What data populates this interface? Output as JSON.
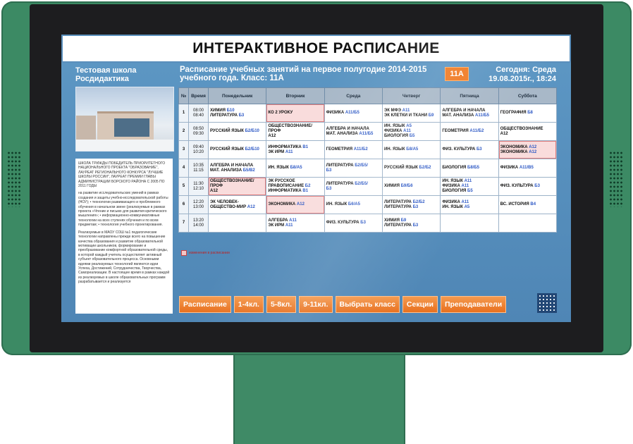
{
  "app": {
    "title": "ИНТЕРАКТИВНОЕ РАСПИСАНИЕ"
  },
  "school": {
    "name_line1": "Тестовая школа",
    "name_line2": "Росдидактика",
    "news": [
      "ШКОЛА ТРИЖДЫ ПОБЕДИТЕЛЬ ПРИОРИТЕТНОГО НАЦИОНАЛЬНОГО ПРОЕКТА \"ОБРАЗОВАНИЕ\", ЛАУРЕАТ РЕГИОНАЛЬНОГО КОНКУРСА \"ЛУЧШИЕ ШКОЛЫ РОССИИ\", ЛАУРЕАТ ПРЕМИИ ГЛАВЫ АДМИНИСТРАЦИИ БОРСКОГО РАЙОНА С 2005 ПО 2011 ГОДЫ",
      "на развитие исследовательских умений в рамках создания и защиты учебно-исследовательской работы (НОУ); • технологии развивающего и проблемного обучения в начальном звене (реализуемые в рамках проекта «Чтение и письмо для развития критического мышления»; • информационно-коммуникативные технологии на всех ступенях обучения и по всем предметам; • технология учебного проектирования.",
      "Реализуемые в МАОУ СОШ №1 педагогические технологии направлены прежде всего на повышение качества образования и развитие образовательной мотивации школьников, формирование и преобразование комфортной образовательной среды, в которой каждый учитель осуществляет активный субъект образовательного процесса. Основными идеями реализуемых технологий являются идеи Успеха, Достижений, Сотрудничества, Творчества, Самореализации. В настоящее время в рамках каждой из реализуемых в школе образовательных программ разрабатывается и реализуется"
    ]
  },
  "schedule": {
    "title_line1": "Расписание учебных занятий на первое полугодие 2014-2015",
    "title_line2": "учебного года. Класс: 11А",
    "class_button": "11А",
    "today_line1": "Сегодня: Среда",
    "today_line2": "19.08.2015г., 18:24",
    "columns": [
      "№",
      "Время",
      "Понедельник",
      "Вторник",
      "Среда",
      "Четверг",
      "Пятница",
      "Суббота"
    ],
    "rows": [
      {
        "num": "1",
        "time": "08:00\n08:40",
        "cells": [
          {
            "hl": false,
            "items": [
              [
                "ХИМИЯ",
                "Б10"
              ],
              [
                "ЛИТЕРАТУРА",
                "Б3"
              ]
            ]
          },
          {
            "hl": true,
            "items": [
              [
                "КО 2 УРОКУ",
                ""
              ]
            ]
          },
          {
            "hl": false,
            "items": [
              [
                "ФИЗИКА",
                "А11/Б5"
              ]
            ]
          },
          {
            "hl": false,
            "items": [
              [
                "ЭК МФЭ",
                "А11"
              ],
              [
                "ЭК КЛЕТКИ И ТКАНИ",
                "Б9"
              ]
            ]
          },
          {
            "hl": false,
            "items": [
              [
                "АЛГЕБРА И НАЧАЛА",
                ""
              ],
              [
                "МАТ. АНАЛИЗА",
                "А11/Б5"
              ]
            ]
          },
          {
            "hl": false,
            "items": [
              [
                "ГЕОГРАФИЯ",
                "Б8"
              ]
            ]
          }
        ]
      },
      {
        "num": "2",
        "time": "08:50\n09:30",
        "cells": [
          {
            "hl": false,
            "items": [
              [
                "РУССКИЙ ЯЗЫК",
                "Б2/Б10"
              ]
            ]
          },
          {
            "hl": false,
            "items": [
              [
                "ОБЩЕСТВОЗНАНИЕ/ПРОФ",
                ""
              ],
              [
                "А12",
                ""
              ]
            ]
          },
          {
            "hl": false,
            "items": [
              [
                "АЛГЕБРА И НАЧАЛА",
                ""
              ],
              [
                "МАТ. АНАЛИЗА",
                "А11/Б5"
              ]
            ]
          },
          {
            "hl": false,
            "items": [
              [
                "ИН. ЯЗЫК",
                "А5"
              ],
              [
                "ФИЗИКА",
                "А11"
              ],
              [
                "БИОЛОГИЯ",
                "Б5"
              ]
            ]
          },
          {
            "hl": false,
            "items": [
              [
                "ГЕОМЕТРИЯ",
                "А11/Б2"
              ]
            ]
          },
          {
            "hl": false,
            "items": [
              [
                "ОБЩЕСТВОЗНАНИЕ",
                ""
              ],
              [
                "А12",
                ""
              ]
            ]
          }
        ]
      },
      {
        "num": "3",
        "time": "09:40\n10:20",
        "cells": [
          {
            "hl": false,
            "items": [
              [
                "РУССКИЙ ЯЗЫК",
                "Б2/Б10"
              ]
            ]
          },
          {
            "hl": false,
            "items": [
              [
                "ИНФОРМАТИКА",
                "В1"
              ],
              [
                "ЭК ИРМ",
                "А11"
              ]
            ]
          },
          {
            "hl": false,
            "items": [
              [
                "ГЕОМЕТРИЯ",
                "А11/Б2"
              ]
            ]
          },
          {
            "hl": false,
            "items": [
              [
                "ИН. ЯЗЫК",
                "Б8/А5"
              ]
            ]
          },
          {
            "hl": false,
            "items": [
              [
                "ФИЗ. КУЛЬТУРА",
                "Б3"
              ]
            ]
          },
          {
            "hl": true,
            "items": [
              [
                "ЭКОНОМИКА",
                "А12"
              ],
              [
                "ЭКОНОМИКА",
                "А12"
              ]
            ]
          }
        ]
      },
      {
        "num": "4",
        "time": "10:35\n11:15",
        "cells": [
          {
            "hl": false,
            "items": [
              [
                "АЛГЕБРА И НАЧАЛА",
                ""
              ],
              [
                "МАТ. АНАЛИЗА",
                "Б5/В2"
              ]
            ]
          },
          {
            "hl": false,
            "items": [
              [
                "ИН. ЯЗЫК",
                "Б8/А5"
              ]
            ]
          },
          {
            "hl": false,
            "items": [
              [
                "ЛИТЕРАТУРА",
                "Б2/Б5/"
              ],
              [
                "",
                "Б3"
              ]
            ]
          },
          {
            "hl": false,
            "items": [
              [
                "РУССКИЙ ЯЗЫК",
                "Б2/Б2"
              ]
            ]
          },
          {
            "hl": false,
            "items": [
              [
                "БИОЛОГИЯ",
                "Б8/Б5"
              ]
            ]
          },
          {
            "hl": false,
            "items": [
              [
                "ФИЗИКА",
                "А11/В5"
              ]
            ]
          }
        ]
      },
      {
        "num": "5",
        "time": "11:30\n12:10",
        "cells": [
          {
            "hl": true,
            "items": [
              [
                "ОБЩЕСТВОЗНАНИЕ/ПРОФ",
                ""
              ],
              [
                "А12",
                ""
              ]
            ]
          },
          {
            "hl": false,
            "items": [
              [
                "ЭК РУССКОЕ",
                ""
              ],
              [
                "ПРАВОПИСАНИЕ",
                "Б2"
              ],
              [
                "ИНФОРМАТИКА",
                "В1"
              ]
            ]
          },
          {
            "hl": false,
            "items": [
              [
                "ЛИТЕРАТУРА",
                "Б2/Б5/"
              ],
              [
                "",
                "Б3"
              ]
            ]
          },
          {
            "hl": false,
            "items": [
              [
                "ХИМИЯ",
                "Б9/Б6"
              ]
            ]
          },
          {
            "hl": false,
            "items": [
              [
                "ИН. ЯЗЫК",
                "А11"
              ],
              [
                "ФИЗИКА",
                "А11"
              ],
              [
                "БИОЛОГИЯ",
                "Б5"
              ]
            ]
          },
          {
            "hl": false,
            "items": [
              [
                "ФИЗ. КУЛЬТУРА",
                "Б3"
              ]
            ]
          }
        ]
      },
      {
        "num": "6",
        "time": "12:20\n13:00",
        "cells": [
          {
            "hl": false,
            "items": [
              [
                "ЭК ЧЕЛОВЕК-",
                ""
              ],
              [
                "ОБЩЕСТВО-МИР",
                "А12"
              ]
            ]
          },
          {
            "hl": true,
            "items": [
              [
                "ЭКОНОМИКА",
                "А12"
              ]
            ]
          },
          {
            "hl": false,
            "items": [
              [
                "ИН. ЯЗЫК",
                "Б6/А5"
              ]
            ]
          },
          {
            "hl": false,
            "items": [
              [
                "ЛИТЕРАТУРА",
                "Б2/Б2"
              ],
              [
                "ЛИТЕРАТУРА",
                "Б3"
              ]
            ]
          },
          {
            "hl": false,
            "items": [
              [
                "ФИЗИКА",
                "А11"
              ],
              [
                "ИН. ЯЗЫК",
                "А5"
              ]
            ]
          },
          {
            "hl": false,
            "items": [
              [
                "ВС. ИСТОРИЯ",
                "В4"
              ]
            ]
          }
        ]
      },
      {
        "num": "7",
        "time": "13:20\n14:00",
        "cells": [
          {
            "hl": false,
            "items": []
          },
          {
            "hl": false,
            "items": [
              [
                "АЛГЕБРА",
                "А11"
              ],
              [
                "ЭК ИРМ",
                "А11"
              ]
            ]
          },
          {
            "hl": false,
            "items": [
              [
                "ФИЗ. КУЛЬТУРА",
                "Б3"
              ]
            ]
          },
          {
            "hl": false,
            "items": [
              [
                "ХИМИЯ",
                "Б9"
              ],
              [
                "ЛИТЕРАТУРА",
                "Б3"
              ]
            ]
          },
          {
            "hl": false,
            "items": []
          },
          {
            "hl": false,
            "items": []
          }
        ]
      }
    ],
    "legend": "изменения в расписании"
  },
  "menu": {
    "buttons": [
      "Расписание",
      "1-4кл.",
      "5-8кл.",
      "9-11кл.",
      "Выбрать класс",
      "Секции",
      "Преподаватели"
    ]
  },
  "colors": {
    "kiosk_green": "#3c8a64",
    "screen_blue": "#5a8fbc",
    "accent_orange": "#f07a22",
    "highlight_red": "#f9dcdc"
  }
}
